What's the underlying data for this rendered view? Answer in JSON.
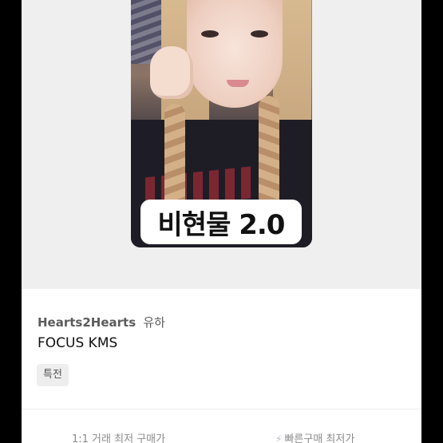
{
  "photocard": {
    "label": "비현물 2.0"
  },
  "product": {
    "group": "Hearts2Hearts",
    "member": "유하",
    "name": "FOCUS KMS",
    "tag": "특전"
  },
  "prices": {
    "left_label": "1:1 거래 최저 구매가",
    "right_label": "빠른구매 최저가"
  },
  "icons": {
    "quick_buy": "bolt-icon"
  },
  "colors": {
    "background": "#000000",
    "card": "#ffffff",
    "image_area": "#efefef",
    "tag_bg": "#eeeeee",
    "muted_text": "#8a8a8a"
  }
}
